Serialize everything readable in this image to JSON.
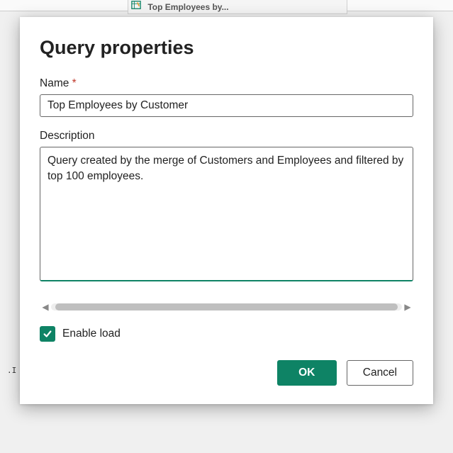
{
  "background": {
    "truncated_query_tab": "Top Employees by...",
    "stray_text": ".I"
  },
  "dialog": {
    "title": "Query properties",
    "name": {
      "label": "Name",
      "required_marker": "*",
      "value": "Top Employees by Customer"
    },
    "description": {
      "label": "Description",
      "value": "Query created by the merge of Customers and Employees and filtered by top 100 employees."
    },
    "enable_load": {
      "label": "Enable load",
      "checked": true
    },
    "buttons": {
      "ok": "OK",
      "cancel": "Cancel"
    }
  },
  "colors": {
    "accent": "#0e8365"
  }
}
